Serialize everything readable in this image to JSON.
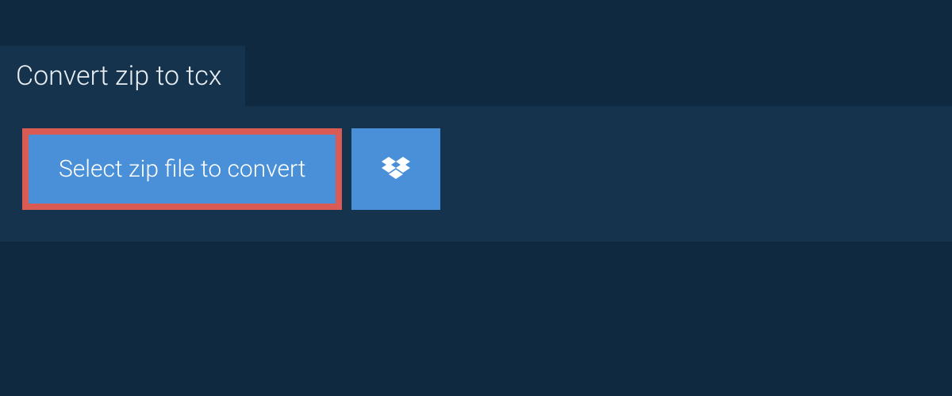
{
  "tab": {
    "title": "Convert zip to tcx"
  },
  "actions": {
    "select_file_label": "Select zip file to convert"
  }
}
